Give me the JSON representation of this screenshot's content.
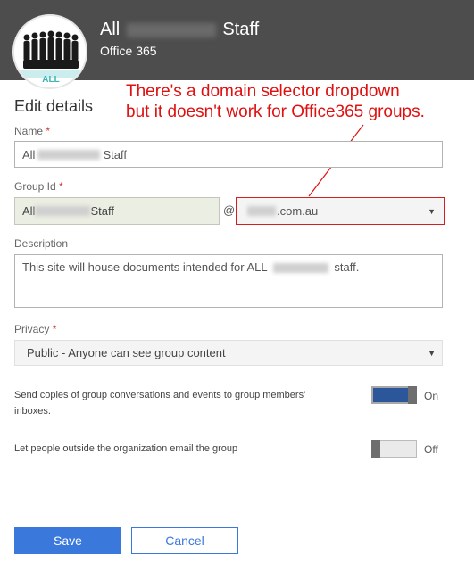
{
  "header": {
    "title_prefix": "All",
    "title_suffix": "Staff",
    "subtitle": "Office 365",
    "avatar_text": "ALL"
  },
  "annotation": {
    "text_line1": "There's a domain selector dropdown",
    "text_line2": "but it doesn't work for Office365 groups.",
    "color": "#e01010"
  },
  "form": {
    "section_title": "Edit details",
    "name": {
      "label": "Name",
      "required_mark": "*",
      "value_prefix": "All",
      "value_suffix": "Staff"
    },
    "group_id": {
      "label": "Group Id",
      "required_mark": "*",
      "value_prefix": "All",
      "value_suffix": "Staff",
      "at_sign": "@",
      "domain_suffix": ".com.au"
    },
    "description": {
      "label": "Description",
      "value_prefix": "This site will house documents intended for ALL",
      "value_suffix": "staff."
    },
    "privacy": {
      "label": "Privacy",
      "required_mark": "*",
      "selected": "Public - Anyone can see group content"
    },
    "settings": [
      {
        "text": "Send copies of group conversations and events to group members' inboxes.",
        "state_label": "On",
        "on": true
      },
      {
        "text": "Let people outside the organization email the group",
        "state_label": "Off",
        "on": false
      }
    ],
    "save_label": "Save",
    "cancel_label": "Cancel"
  },
  "colors": {
    "header_bg": "#4d4d4d",
    "accent": "#3a78dc",
    "toggle_on": "#2b579a",
    "required": "#d13438"
  }
}
